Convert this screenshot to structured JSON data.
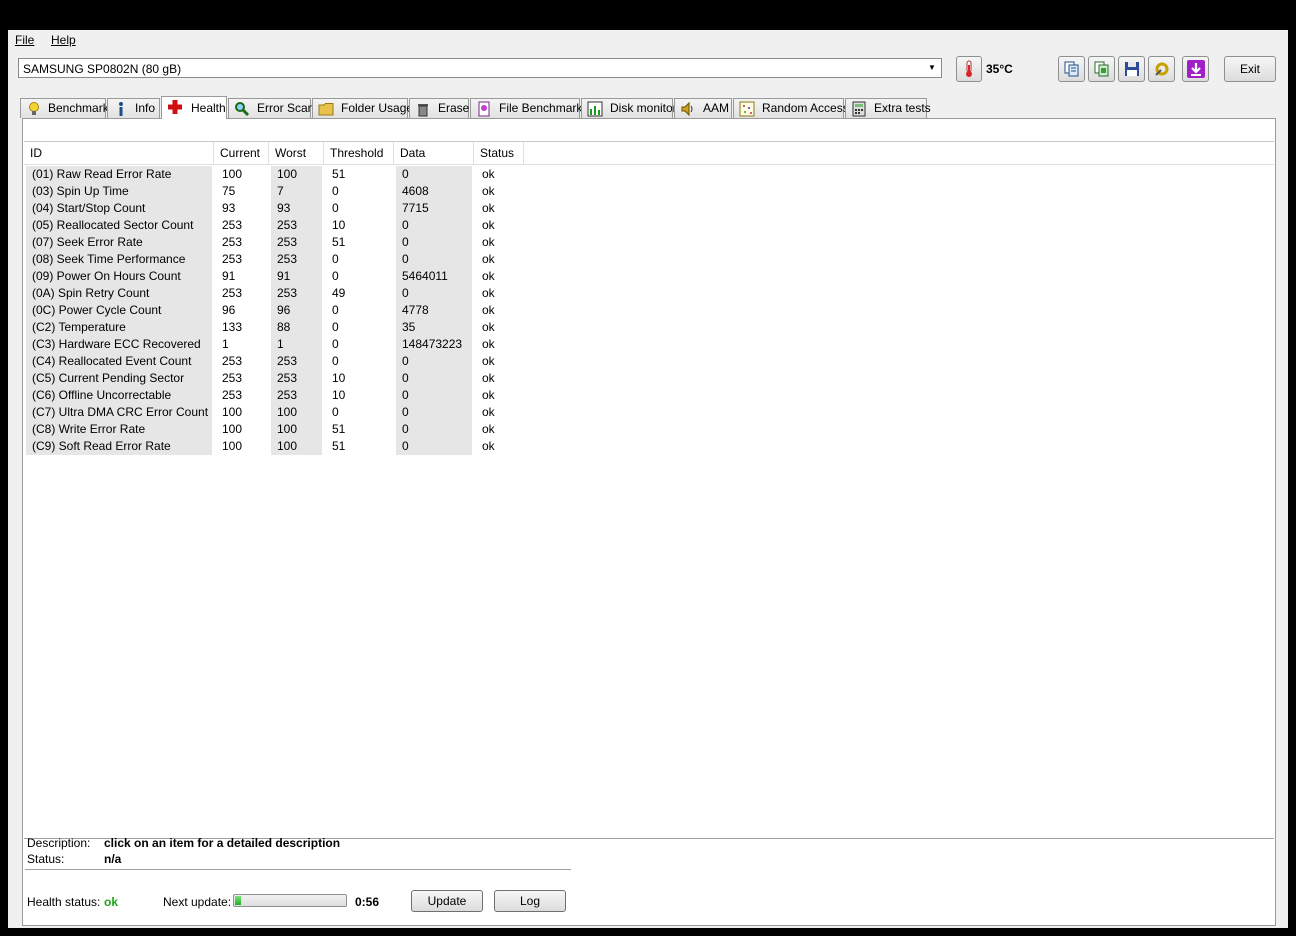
{
  "menu": {
    "file": "File",
    "help": "Help"
  },
  "drive": {
    "selected": "SAMSUNG SP0802N (80 gB)"
  },
  "temperature": "35°C",
  "toolbar": {
    "exit_label": "Exit"
  },
  "tabs": [
    {
      "label": "Benchmark",
      "icon": "bulb-icon"
    },
    {
      "label": "Info",
      "icon": "info-icon"
    },
    {
      "label": "Health",
      "icon": "red-cross-icon",
      "active": true
    },
    {
      "label": "Error Scan",
      "icon": "magnifier-icon"
    },
    {
      "label": "Folder Usage",
      "icon": "folder-icon"
    },
    {
      "label": "Erase",
      "icon": "trash-icon"
    },
    {
      "label": "File Benchmark",
      "icon": "file-bench-icon"
    },
    {
      "label": "Disk monitor",
      "icon": "chart-icon"
    },
    {
      "label": "AAM",
      "icon": "speaker-icon"
    },
    {
      "label": "Random Access",
      "icon": "dots-icon"
    },
    {
      "label": "Extra tests",
      "icon": "calculator-icon"
    }
  ],
  "table": {
    "headers": [
      "ID",
      "Current",
      "Worst",
      "Threshold",
      "Data",
      "Status"
    ],
    "rows": [
      [
        "(01) Raw Read Error Rate",
        "100",
        "100",
        "51",
        "0",
        "ok"
      ],
      [
        "(03) Spin Up Time",
        "75",
        "7",
        "0",
        "4608",
        "ok"
      ],
      [
        "(04) Start/Stop Count",
        "93",
        "93",
        "0",
        "7715",
        "ok"
      ],
      [
        "(05) Reallocated Sector Count",
        "253",
        "253",
        "10",
        "0",
        "ok"
      ],
      [
        "(07) Seek Error Rate",
        "253",
        "253",
        "51",
        "0",
        "ok"
      ],
      [
        "(08) Seek Time Performance",
        "253",
        "253",
        "0",
        "0",
        "ok"
      ],
      [
        "(09) Power On Hours Count",
        "91",
        "91",
        "0",
        "5464011",
        "ok"
      ],
      [
        "(0A) Spin Retry Count",
        "253",
        "253",
        "49",
        "0",
        "ok"
      ],
      [
        "(0C) Power Cycle Count",
        "96",
        "96",
        "0",
        "4778",
        "ok"
      ],
      [
        "(C2) Temperature",
        "133",
        "88",
        "0",
        "35",
        "ok"
      ],
      [
        "(C3) Hardware ECC Recovered",
        "1",
        "1",
        "0",
        "148473223",
        "ok"
      ],
      [
        "(C4) Reallocated Event Count",
        "253",
        "253",
        "0",
        "0",
        "ok"
      ],
      [
        "(C5) Current Pending Sector",
        "253",
        "253",
        "10",
        "0",
        "ok"
      ],
      [
        "(C6) Offline Uncorrectable",
        "253",
        "253",
        "10",
        "0",
        "ok"
      ],
      [
        "(C7) Ultra DMA CRC Error Count",
        "100",
        "100",
        "0",
        "0",
        "ok"
      ],
      [
        "(C8) Write Error Rate",
        "100",
        "100",
        "51",
        "0",
        "ok"
      ],
      [
        "(C9) Soft Read Error Rate",
        "100",
        "100",
        "51",
        "0",
        "ok"
      ]
    ]
  },
  "details": {
    "description_label": "Description:",
    "description_value": "click on an item for a detailed description",
    "status_label": "Status:",
    "status_value": "n/a"
  },
  "footer": {
    "health_label": "Health status:",
    "health_value": "ok",
    "next_update_label": "Next update:",
    "progress_fraction": 0.05,
    "time_remaining": "0:56",
    "update_label": "Update",
    "log_label": "Log"
  }
}
